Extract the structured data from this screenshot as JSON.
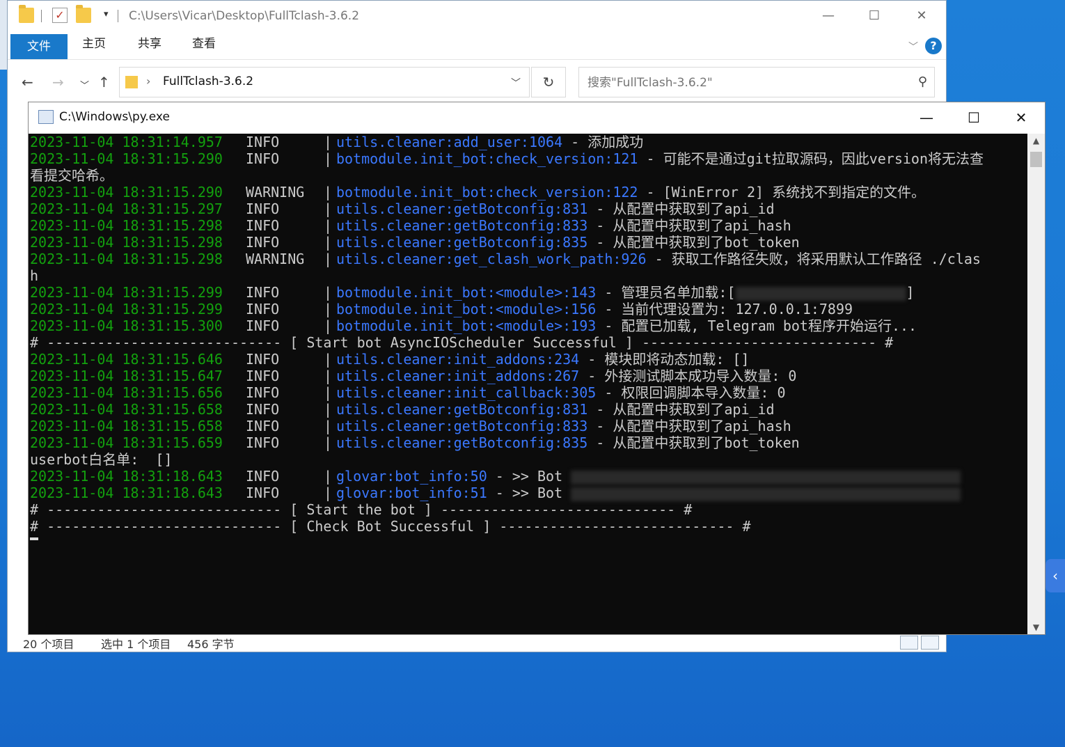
{
  "explorer": {
    "title_path": "C:\\Users\\Vicar\\Desktop\\FullTclash-3.6.2",
    "ribbon_tabs": [
      "文件",
      "主页",
      "共享",
      "查看"
    ],
    "address_text": "FullTclash-3.6.2",
    "search_placeholder": "搜索\"FullTclash-3.6.2\"",
    "status": {
      "items_count": "20 个项目",
      "selected": "选中 1 个项目",
      "size": "456 字节"
    }
  },
  "console": {
    "title": "C:\\Windows\\py.exe",
    "lines": [
      {
        "kind": "log",
        "ts": "2023-11-04 18:31:14.957",
        "level": "INFO",
        "module": "utils.cleaner:add_user:1064",
        "msg": " - 添加成功"
      },
      {
        "kind": "log",
        "ts": "2023-11-04 18:31:15.290",
        "level": "INFO",
        "module": "botmodule.init_bot:check_version:121",
        "msg": " - 可能不是通过git拉取源码，因此version将无法查"
      },
      {
        "kind": "text",
        "text": "看提交哈希。"
      },
      {
        "kind": "log",
        "ts": "2023-11-04 18:31:15.290",
        "level": "WARNING",
        "module": "botmodule.init_bot:check_version:122",
        "msg": " - [WinError 2] 系统找不到指定的文件。"
      },
      {
        "kind": "log",
        "ts": "2023-11-04 18:31:15.297",
        "level": "INFO",
        "module": "utils.cleaner:getBotconfig:831",
        "msg": " - 从配置中获取到了api_id"
      },
      {
        "kind": "log",
        "ts": "2023-11-04 18:31:15.298",
        "level": "INFO",
        "module": "utils.cleaner:getBotconfig:833",
        "msg": " - 从配置中获取到了api_hash"
      },
      {
        "kind": "log",
        "ts": "2023-11-04 18:31:15.298",
        "level": "INFO",
        "module": "utils.cleaner:getBotconfig:835",
        "msg": " - 从配置中获取到了bot_token"
      },
      {
        "kind": "log",
        "ts": "2023-11-04 18:31:15.298",
        "level": "WARNING",
        "module": "utils.cleaner:get_clash_work_path:926",
        "msg": " - 获取工作路径失败，将采用默认工作路径 ./clas"
      },
      {
        "kind": "text",
        "text": "h"
      },
      {
        "kind": "log",
        "ts": "2023-11-04 18:31:15.299",
        "level": "INFO",
        "module": "botmodule.init_bot:<module>:143",
        "msg": " - 管理员名单加载:[",
        "blur": true,
        "after": "]"
      },
      {
        "kind": "log",
        "ts": "2023-11-04 18:31:15.299",
        "level": "INFO",
        "module": "botmodule.init_bot:<module>:156",
        "msg": " - 当前代理设置为: 127.0.0.1:7899"
      },
      {
        "kind": "log",
        "ts": "2023-11-04 18:31:15.300",
        "level": "INFO",
        "module": "botmodule.init_bot:<module>:193",
        "msg": " - 配置已加载, Telegram bot程序开始运行..."
      },
      {
        "kind": "text",
        "text": "# ---------------------------- [ Start bot AsyncIOScheduler Successful ] ---------------------------- #"
      },
      {
        "kind": "log",
        "ts": "2023-11-04 18:31:15.646",
        "level": "INFO",
        "module": "utils.cleaner:init_addons:234",
        "msg": " - 模块即将动态加载: []"
      },
      {
        "kind": "log",
        "ts": "2023-11-04 18:31:15.647",
        "level": "INFO",
        "module": "utils.cleaner:init_addons:267",
        "msg": " - 外接测试脚本成功导入数量: 0"
      },
      {
        "kind": "log",
        "ts": "2023-11-04 18:31:15.656",
        "level": "INFO",
        "module": "utils.cleaner:init_callback:305",
        "msg": " - 权限回调脚本导入数量: 0"
      },
      {
        "kind": "log",
        "ts": "2023-11-04 18:31:15.658",
        "level": "INFO",
        "module": "utils.cleaner:getBotconfig:831",
        "msg": " - 从配置中获取到了api_id"
      },
      {
        "kind": "log",
        "ts": "2023-11-04 18:31:15.658",
        "level": "INFO",
        "module": "utils.cleaner:getBotconfig:833",
        "msg": " - 从配置中获取到了api_hash"
      },
      {
        "kind": "log",
        "ts": "2023-11-04 18:31:15.659",
        "level": "INFO",
        "module": "utils.cleaner:getBotconfig:835",
        "msg": " - 从配置中获取到了bot_token"
      },
      {
        "kind": "text",
        "text": "userbot白名单:  []"
      },
      {
        "kind": "log",
        "ts": "2023-11-04 18:31:18.643",
        "level": "INFO",
        "module": "glovar:bot_info:50",
        "msg": " - >> Bot ",
        "blur": true,
        "after": ""
      },
      {
        "kind": "log",
        "ts": "2023-11-04 18:31:18.643",
        "level": "INFO",
        "module": "glovar:bot_info:51",
        "msg": " - >> Bot ",
        "blur": true,
        "after": ""
      },
      {
        "kind": "text",
        "text": "# ---------------------------- [ Start the bot ] ---------------------------- #"
      },
      {
        "kind": "text",
        "text": "# ---------------------------- [ Check Bot Successful ] ---------------------------- #"
      }
    ]
  },
  "colors": {
    "timestamp": "#13a10e",
    "module": "#3b78ff",
    "text": "#cccccc",
    "ribbon_accent": "#1979ca"
  }
}
